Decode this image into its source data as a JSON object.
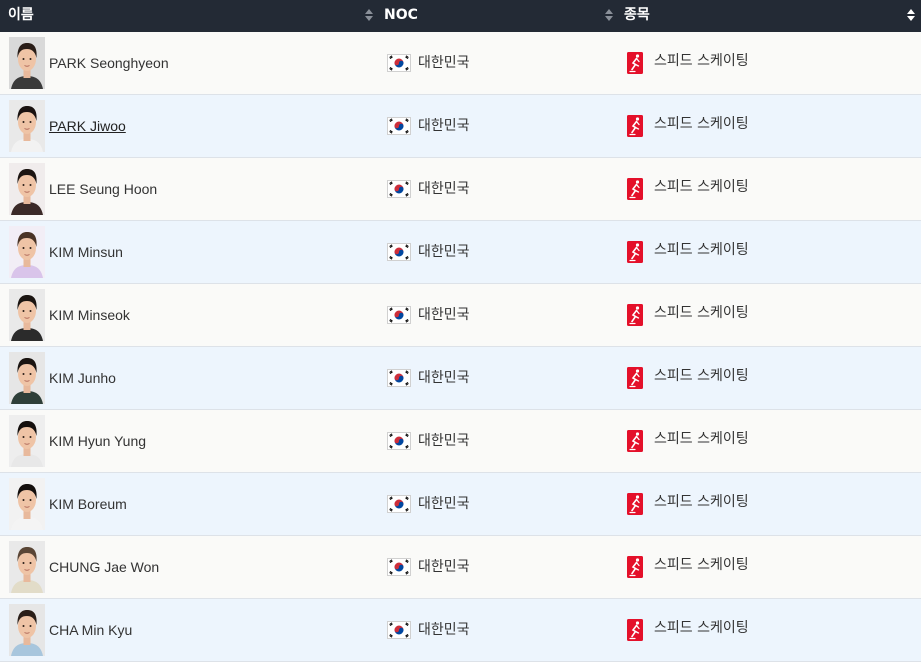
{
  "header": {
    "col_name": "이름",
    "col_noc": "NOC",
    "col_sport": "종목"
  },
  "colors": {
    "header_bg": "#232a35",
    "row_odd": "#fafaf8",
    "row_even": "#edf5fd",
    "sport_icon": "#e4102a"
  },
  "rows": [
    {
      "name": "PARK Seonghyeon",
      "noc": "대한민국",
      "sport": "스피드 스케이팅",
      "hair": "#2a1e18",
      "shirt": "#3a3a3a",
      "bg": "#d9d9d9"
    },
    {
      "name": "PARK Jiwoo",
      "noc": "대한민국",
      "sport": "스피드 스케이팅",
      "hair": "#1a1210",
      "shirt": "#f2f2f2",
      "bg": "#e9e9e9"
    },
    {
      "name": "LEE Seung Hoon",
      "noc": "대한민국",
      "sport": "스피드 스케이팅",
      "hair": "#1c1512",
      "shirt": "#3b2a28",
      "bg": "#f0ecec"
    },
    {
      "name": "KIM Minsun",
      "noc": "대한민국",
      "sport": "스피드 스케이팅",
      "hair": "#4a3426",
      "shirt": "#d9c4ea",
      "bg": "#f2eef6"
    },
    {
      "name": "KIM Minseok",
      "noc": "대한민국",
      "sport": "스피드 스케이팅",
      "hair": "#1a1411",
      "shirt": "#2b2b2b",
      "bg": "#e9e9e9"
    },
    {
      "name": "KIM Junho",
      "noc": "대한민국",
      "sport": "스피드 스케이팅",
      "hair": "#1a1411",
      "shirt": "#2f3f39",
      "bg": "#e6e6e6"
    },
    {
      "name": "KIM Hyun Yung",
      "noc": "대한민국",
      "sport": "스피드 스케이팅",
      "hair": "#140f0d",
      "shirt": "#e8e8e8",
      "bg": "#eeeeee"
    },
    {
      "name": "KIM Boreum",
      "noc": "대한민국",
      "sport": "스피드 스케이팅",
      "hair": "#140f0d",
      "shirt": "#f4f4f4",
      "bg": "#f2f2f2"
    },
    {
      "name": "CHUNG Jae Won",
      "noc": "대한민국",
      "sport": "스피드 스케이팅",
      "hair": "#5a4636",
      "shirt": "#e2dcc8",
      "bg": "#e9e9e9"
    },
    {
      "name": "CHA Min Kyu",
      "noc": "대한민국",
      "sport": "스피드 스케이팅",
      "hair": "#2a1e18",
      "shirt": "#a8c6dd",
      "bg": "#e6e6e6"
    }
  ]
}
